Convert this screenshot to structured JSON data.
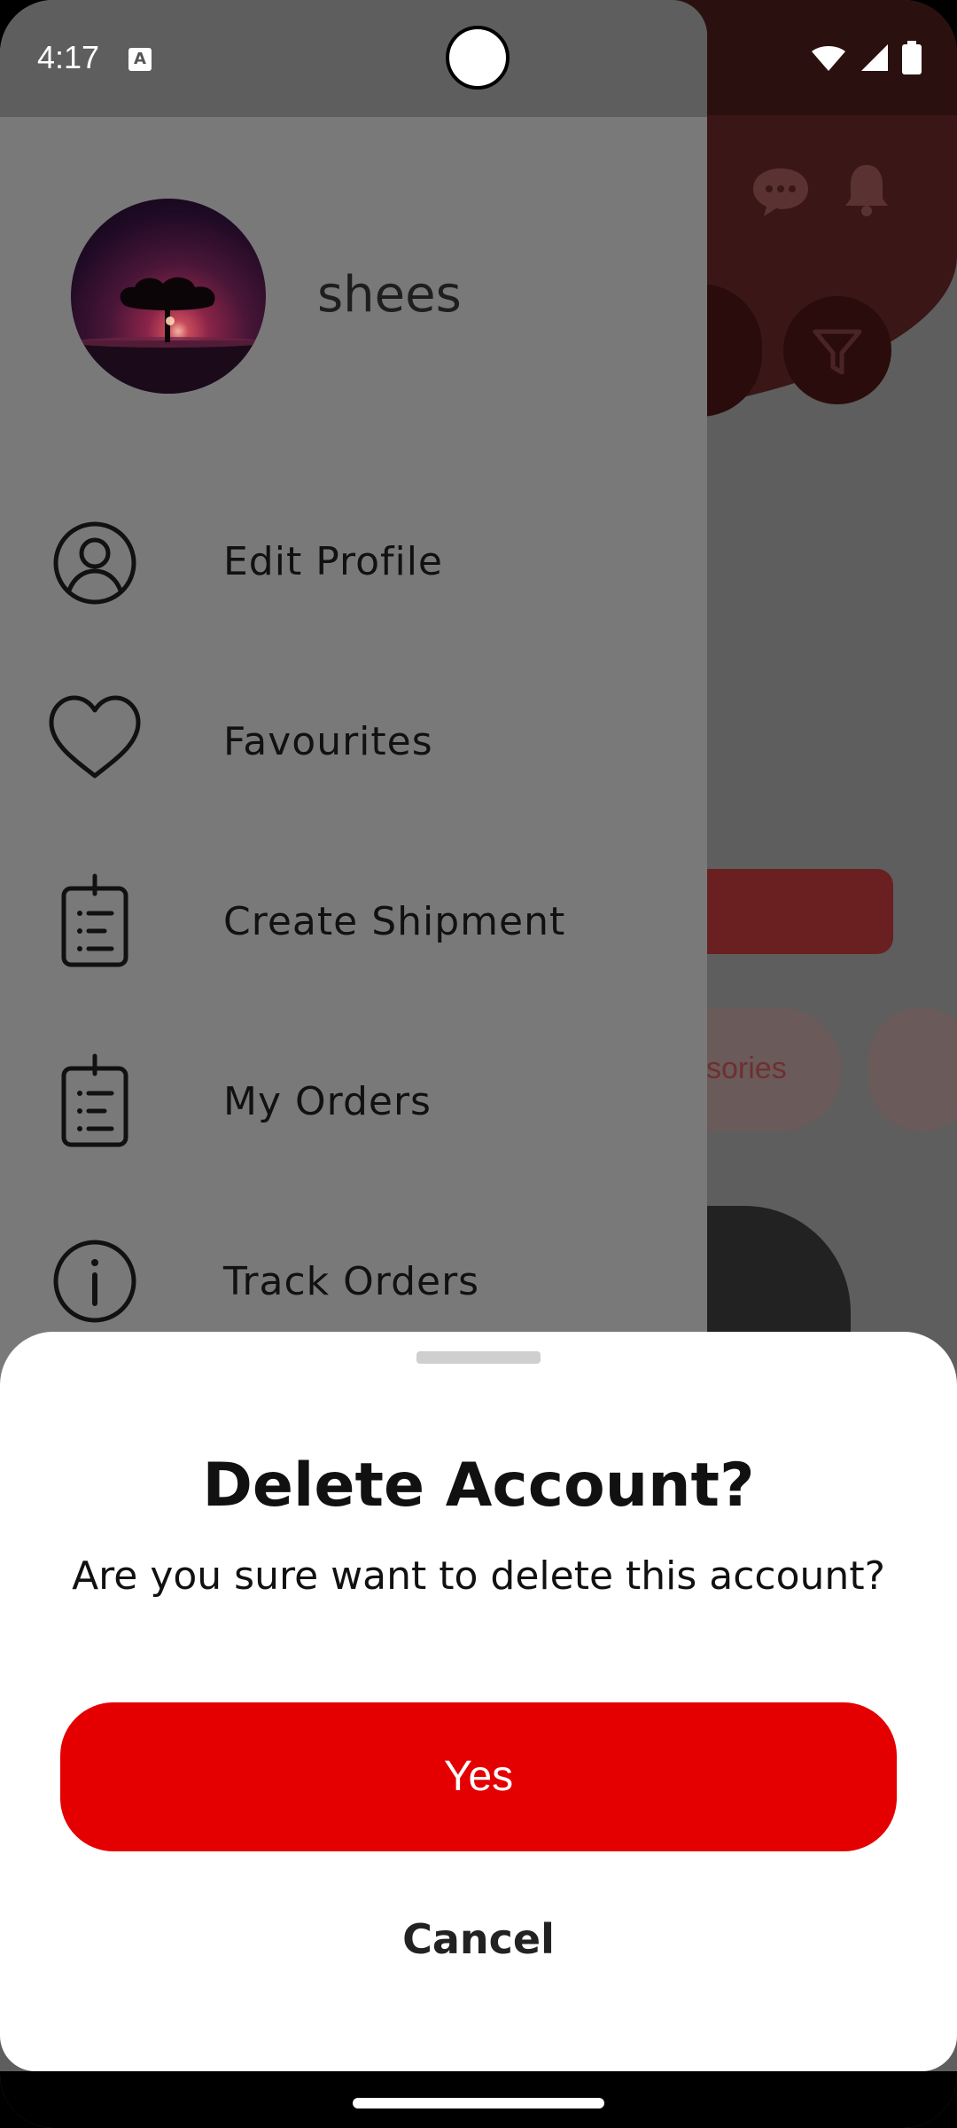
{
  "status_bar": {
    "time": "4:17",
    "indicator_letter": "A"
  },
  "background": {
    "chip_text": "ssories"
  },
  "drawer": {
    "user_name": "shees",
    "items": [
      {
        "label": "Edit Profile",
        "icon": "person-circle-icon"
      },
      {
        "label": "Favourites",
        "icon": "heart-icon"
      },
      {
        "label": "Create Shipment",
        "icon": "clipboard-icon"
      },
      {
        "label": "My Orders",
        "icon": "clipboard-icon"
      },
      {
        "label": "Track Orders",
        "icon": "info-icon"
      }
    ]
  },
  "sheet": {
    "title": "Delete Account?",
    "message": "Are you sure want to delete this account?",
    "yes_label": "Yes",
    "cancel_label": "Cancel"
  },
  "colors": {
    "accent": "#e40000",
    "drawer_bg": "#797979",
    "sheet_bg": "#ffffff"
  }
}
